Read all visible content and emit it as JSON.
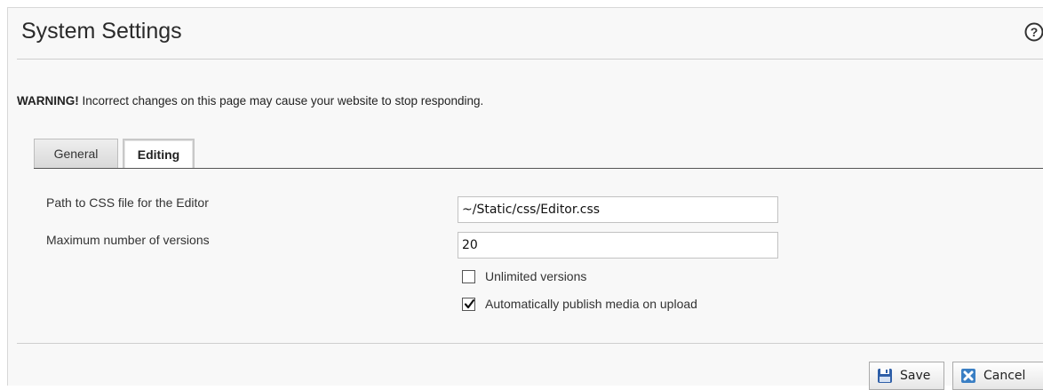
{
  "page": {
    "title": "System Settings",
    "help_icon": "help-circle-icon"
  },
  "warning": {
    "strong": "WARNING!",
    "text": " Incorrect changes on this page may cause your website to stop responding."
  },
  "tabs": [
    {
      "label": "General",
      "active": false
    },
    {
      "label": "Editing",
      "active": true
    }
  ],
  "fields": {
    "css_path": {
      "label": "Path to CSS file for the Editor",
      "value": "~/Static/css/Editor.css"
    },
    "max_versions": {
      "label": "Maximum number of versions",
      "value": "20"
    }
  },
  "checkboxes": {
    "unlimited_versions": {
      "label": "Unlimited versions",
      "checked": false
    },
    "auto_publish": {
      "label": "Automatically publish media on upload",
      "checked": true
    }
  },
  "buttons": {
    "save": {
      "label": "Save",
      "icon": "floppy-disk-icon",
      "icon_color": "#2f5fa8"
    },
    "cancel": {
      "label": "Cancel",
      "icon": "close-square-icon",
      "icon_color": "#3a7fc4"
    }
  }
}
